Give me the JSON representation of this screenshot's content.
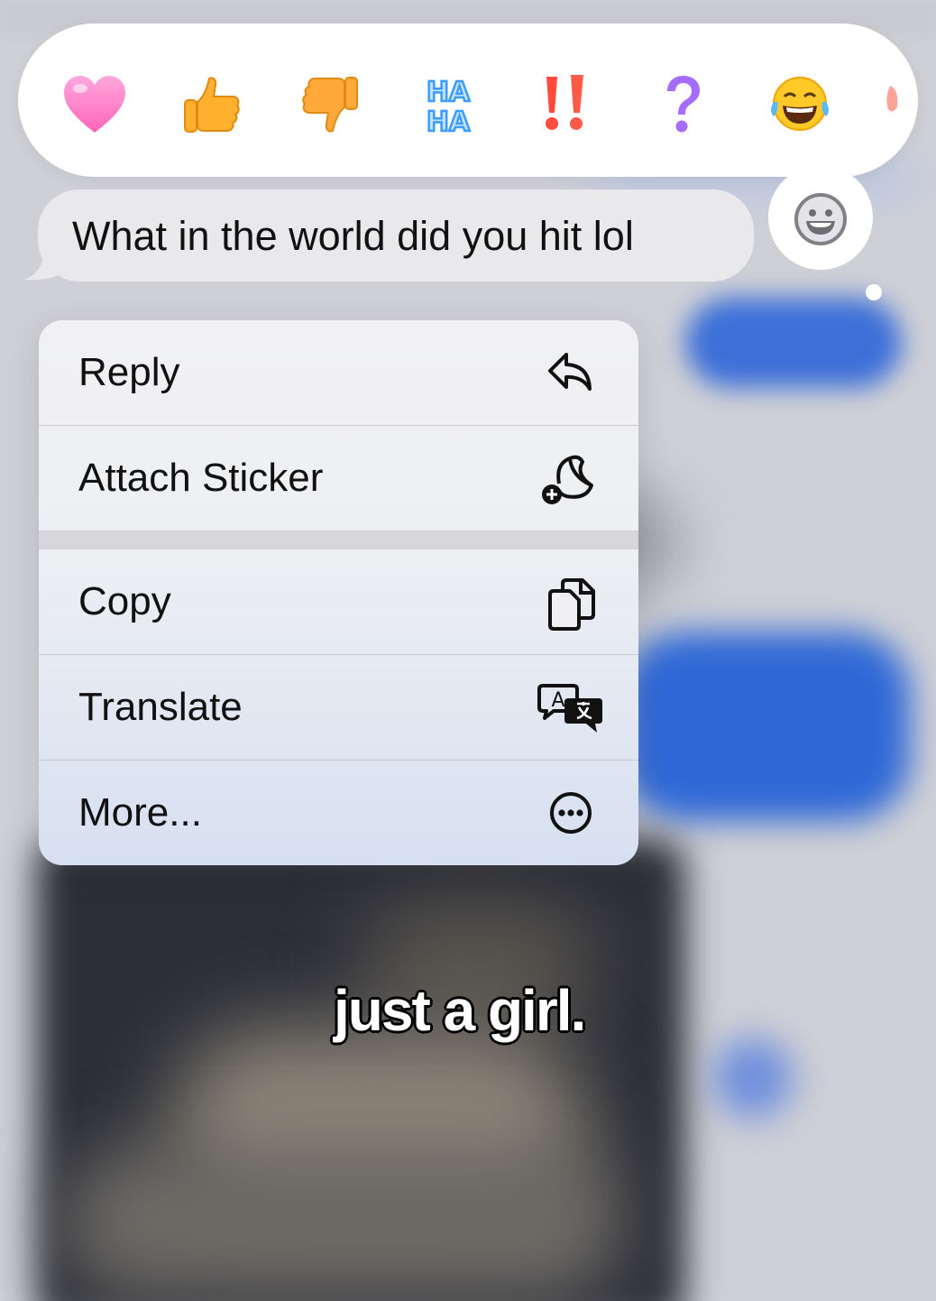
{
  "reactions": [
    {
      "name": "heart",
      "icon": "heart-icon"
    },
    {
      "name": "thumbs up",
      "icon": "thumbs-up-icon"
    },
    {
      "name": "thumbs down",
      "icon": "thumbs-down-icon"
    },
    {
      "name": "haha",
      "icon": "haha-icon",
      "text_top": "HA",
      "text_bottom": "HA"
    },
    {
      "name": "emphasize",
      "icon": "double-exclamation-icon"
    },
    {
      "name": "question",
      "icon": "question-mark-icon"
    },
    {
      "name": "laughing",
      "icon": "tears-of-joy-icon"
    }
  ],
  "add_emoji": {
    "icon": "smiley-add-icon"
  },
  "message": {
    "text": "What in the world did you hit lol"
  },
  "menu": {
    "items": [
      {
        "label": "Reply",
        "icon": "reply-icon"
      },
      {
        "label": "Attach Sticker",
        "icon": "sticker-add-icon"
      },
      {
        "label": "Copy",
        "icon": "copy-icon"
      },
      {
        "label": "Translate",
        "icon": "translate-icon"
      },
      {
        "label": "More...",
        "icon": "more-ellipsis-icon"
      }
    ]
  },
  "caption": {
    "text": "just a girl."
  },
  "colors": {
    "bubble_gray": "#e9e9eb",
    "accent_blue": "#2f68d6",
    "heart_pink": "#ff7fc8",
    "thumb_orange": "#ffb02e",
    "haha_blue": "#4aa8ff",
    "emphasis_red": "#ff4a3d",
    "question_purple": "#a66bff"
  }
}
